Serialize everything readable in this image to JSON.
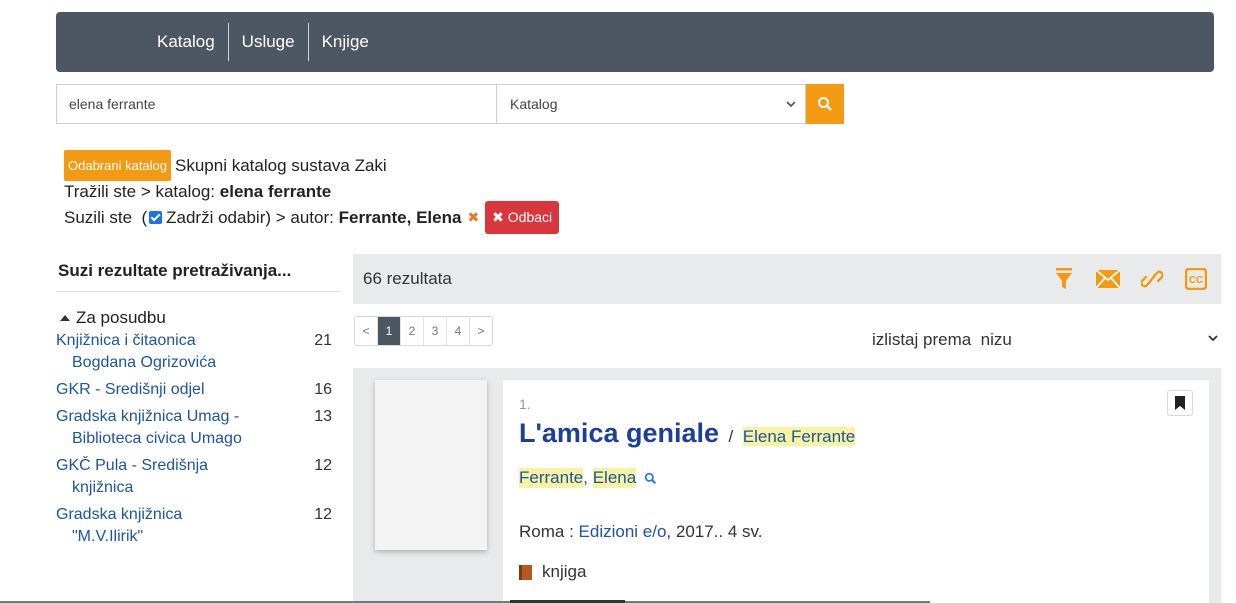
{
  "nav": {
    "items": [
      "Katalog",
      "Usluge",
      "Knjige"
    ]
  },
  "search": {
    "query": "elena ferrante",
    "scope": "Katalog",
    "button_icon": "search-icon"
  },
  "breadcrumbs": {
    "catalog_badge": "Odabrani katalog",
    "catalog_name": "Skupni katalog sustava Zaki",
    "searched_prefix": "Tražili ste > katalog:",
    "searched_term": "elena ferrante",
    "narrowed_prefix": "Suzili ste",
    "keep_selection": "Zadrži odabir)",
    "narrowed_field": "> autor:",
    "narrowed_value": "Ferrante, Elena",
    "discard_label": "Odbaci"
  },
  "facets": {
    "title": "Suzi rezultate pretraživanja...",
    "group_label": "Za posudbu",
    "items": [
      {
        "line1": "Knjižnica i čitaonica",
        "line2": "Bogdana Ogrizovića",
        "count": "21"
      },
      {
        "line1": "GKR - Središnji odjel",
        "line2": "",
        "count": "16"
      },
      {
        "line1": "Gradska knjižnica Umag -",
        "line2": "Biblioteca civica Umago",
        "count": "13"
      },
      {
        "line1": "GKČ Pula - Središnja",
        "line2": "knjižnica",
        "count": "12"
      },
      {
        "line1": "Gradska knjižnica",
        "line2": "\"M.V.Ilirik\"",
        "count": "12"
      }
    ]
  },
  "results": {
    "count_label": "66 rezultata",
    "tools": [
      "filter-icon",
      "email-icon",
      "link-icon",
      "citation-icon"
    ],
    "pagination": [
      "<",
      "1",
      "2",
      "3",
      "4",
      ">"
    ],
    "current_page": "1",
    "sort_label": "izlistaj prema",
    "sort_value": "nizu"
  },
  "record": {
    "number": "1.",
    "title": "L'amica geniale",
    "slash": "/",
    "statement": "Elena Ferrante",
    "author_last": "Ferrante",
    "author_sep": ",",
    "author_first": "Elena",
    "pub_place": "Roma :",
    "publisher": "Edizioni e/o",
    "pub_rest": ", 2017.. 4 sv.",
    "type": "knjiga"
  },
  "colors": {
    "nav_bg": "#4d5763",
    "accent_orange": "#f49a12",
    "link_blue": "#1b56a2",
    "title_blue": "#1b3f9a",
    "danger_red": "#d9363e",
    "highlight": "#f7f3a3"
  }
}
